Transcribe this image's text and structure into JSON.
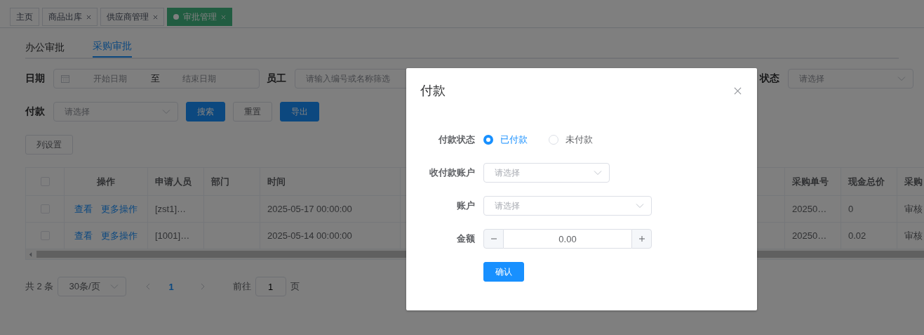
{
  "tabs": [
    {
      "label": "主页",
      "closable": false,
      "selected": false
    },
    {
      "label": "商品出库",
      "closable": true,
      "selected": false
    },
    {
      "label": "供应商管理",
      "closable": true,
      "selected": false
    },
    {
      "label": "审批管理",
      "closable": true,
      "selected": true
    }
  ],
  "subtabs": [
    {
      "label": "办公审批",
      "selected": false
    },
    {
      "label": "采购审批",
      "selected": true
    }
  ],
  "filters": {
    "date": {
      "label": "日期",
      "start_placeholder": "开始日期",
      "separator": "至",
      "end_placeholder": "结束日期"
    },
    "employee": {
      "label": "员工",
      "placeholder": "请输入编号或名称筛选"
    },
    "status": {
      "label": "状态",
      "placeholder": "请选择"
    },
    "payment": {
      "label": "付款",
      "placeholder": "请选择"
    },
    "buttons": [
      {
        "label": "搜索",
        "kind": "primary"
      },
      {
        "label": "重置",
        "kind": "default"
      },
      {
        "label": "导出",
        "kind": "primary"
      }
    ]
  },
  "column_settings": "列设置",
  "table": {
    "header_checked": false,
    "columns_left": [
      "操作",
      "申请人员",
      "部门",
      "时间"
    ],
    "columns_right": [
      "采购单号",
      "现金总价",
      "采购"
    ],
    "rows": [
      {
        "checked": false,
        "actions": [
          "查看",
          "更多操作"
        ],
        "applicant": "[zst1]…",
        "department": "",
        "time": "2025-05-17 00:00:00",
        "order_no": "20250…",
        "cash_total": "0",
        "column_right_3": "审核"
      },
      {
        "checked": false,
        "actions": [
          "查看",
          "更多操作"
        ],
        "applicant": "[1001]…",
        "department": "",
        "time": "2025-05-14 00:00:00",
        "order_no": "20250…",
        "cash_total": "0.02",
        "column_right_3": "审核"
      }
    ]
  },
  "pagination": {
    "total": "共 2 条",
    "page_size": "30条/页",
    "pages": [
      {
        "label": "1",
        "selected": true
      }
    ],
    "goto_label": "前往",
    "goto_value": "1",
    "page_suffix": "页"
  },
  "dialog": {
    "title": "付款",
    "status_label": "付款状态",
    "status_options": [
      {
        "label": "已付款",
        "selected": true
      },
      {
        "label": "未付款",
        "selected": false
      }
    ],
    "account_type_label": "收付款账户",
    "account_type_placeholder": "请选择",
    "account_label": "账户",
    "account_placeholder": "请选择",
    "amount_label": "金额",
    "amount_value": "0.00",
    "confirm": "确认"
  }
}
